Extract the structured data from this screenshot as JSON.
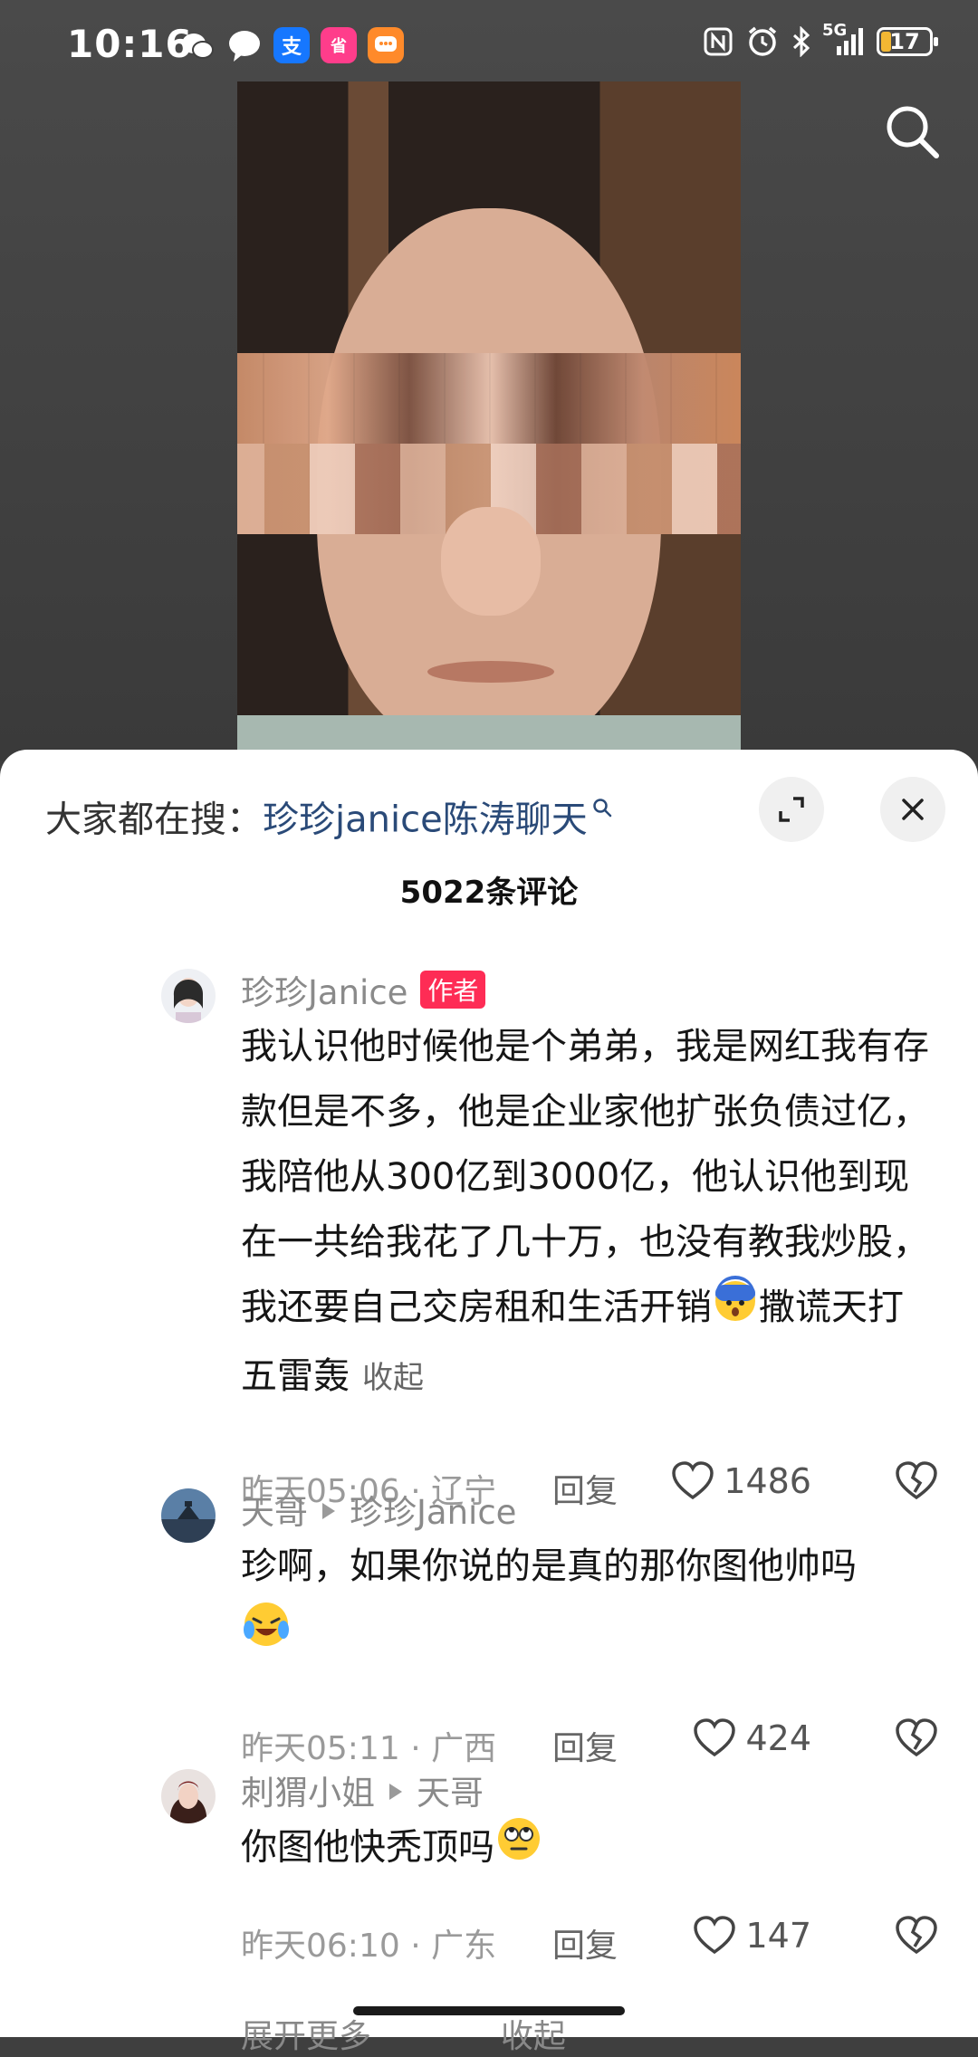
{
  "status_bar": {
    "time": "10:16",
    "network": "5G",
    "battery": "17",
    "app_icons": [
      "wechat-icon",
      "chat-bubble-icon",
      "alipay-icon",
      "shopping-app-icon",
      "message-app-icon"
    ],
    "alipay_glyph": "支",
    "shop_glyph": "省"
  },
  "search_hint": {
    "prefix": "大家都在搜：",
    "keyword": "珍珍janice陈涛聊天"
  },
  "comment_count": "5022条评论",
  "comments": [
    {
      "author": "珍珍Janice",
      "author_tag": "作者",
      "text_before_emoji": "我认识他时候他是个弟弟，我是网红我有存款但是不多，他是企业家他扩张负债过亿，我陪他从300亿到3000亿，他认识他到现在一共给我花了几十万，也没有教我炒股，我还要自己交房租和生活开销",
      "text_after_emoji": "撒谎天打五雷轰",
      "collapse_label": "收起",
      "date": "昨天05:06 · 辽宁",
      "reply_label": "回复",
      "likes": "1486"
    },
    {
      "author": "天哥",
      "reply_to": "珍珍Janice",
      "text": "珍啊，如果你说的是真的那你图他帅吗",
      "date": "昨天05:11 · 广西",
      "reply_label": "回复",
      "likes": "424"
    },
    {
      "author": "刺猬小姐",
      "reply_to": "天哥",
      "text": "你图他快秃顶吗",
      "date": "昨天06:10 · 广东",
      "reply_label": "回复",
      "likes": "147"
    }
  ],
  "more_row": {
    "expand": "展开更多",
    "collapse": "收起"
  },
  "colors": {
    "author_tag_bg": "#fe2c55",
    "keyword": "#2a4a78",
    "panel_bg": "#ffffff"
  }
}
